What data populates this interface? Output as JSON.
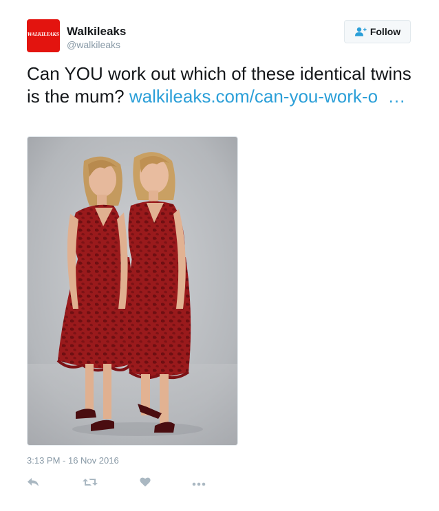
{
  "account": {
    "avatar_text": "WALKILEAKS",
    "name": "Walkileaks",
    "handle": "@walkileaks"
  },
  "follow_button": {
    "label": "Follow",
    "icon": "add-user-icon"
  },
  "tweet": {
    "text": "Can YOU work out which of these identical twins is the mum? ",
    "link": "walkileaks.com/can-you-work-o  …",
    "media_description_icon": "photo"
  },
  "timestamp": "3:13 PM - 16 Nov 2016",
  "actions": [
    {
      "name": "reply",
      "icon": "reply-icon"
    },
    {
      "name": "retweet",
      "icon": "retweet-icon"
    },
    {
      "name": "like",
      "icon": "heart-icon"
    },
    {
      "name": "more",
      "icon": "more-icon"
    }
  ],
  "colors": {
    "brand_red": "#e3140f",
    "link": "#2b9fd8",
    "muted": "#8899a6",
    "dress": "#9a1a1c"
  }
}
